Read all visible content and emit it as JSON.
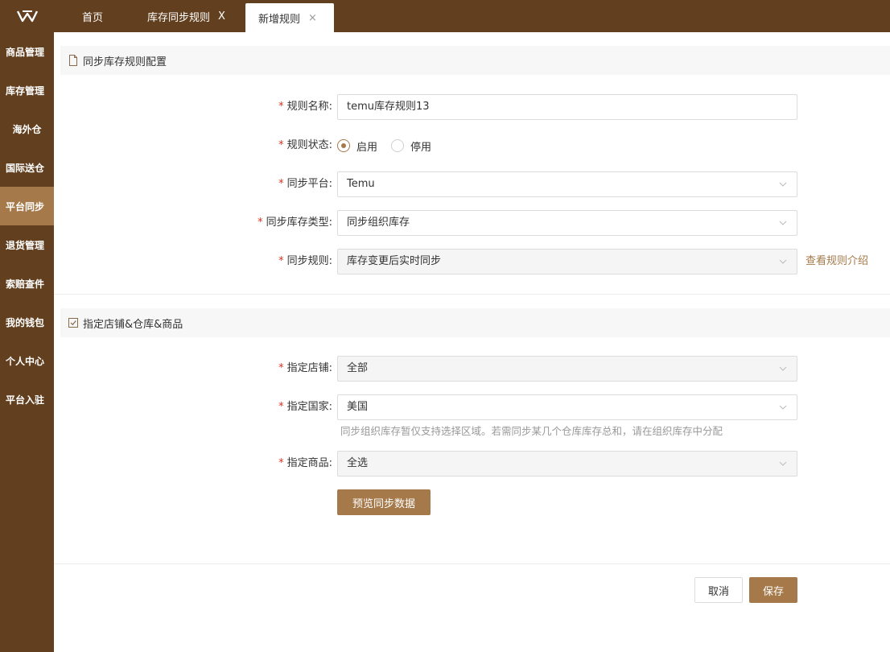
{
  "tabs": {
    "home": "首页",
    "rules": "库存同步规则",
    "new_rule": "新增规则",
    "close_glyph": "X",
    "close_glyph_small": "×"
  },
  "sidebar": {
    "items": [
      "商品管理",
      "库存管理",
      "海外仓",
      "国际送仓",
      "平台同步",
      "退货管理",
      "索赔查件",
      "我的钱包",
      "个人中心",
      "平台入驻"
    ],
    "active_index": 4
  },
  "section1": {
    "title": "同步库存规则配置",
    "rule_name": {
      "label": "规则名称:",
      "value": "temu库存规则13"
    },
    "rule_status": {
      "label": "规则状态:",
      "options": [
        "启用",
        "停用"
      ],
      "selected": "启用"
    },
    "platform": {
      "label": "同步平台:",
      "value": "Temu"
    },
    "stock_type": {
      "label": "同步库存类型:",
      "value": "同步组织库存"
    },
    "sync_rule": {
      "label": "同步规则:",
      "value": "库存变更后实时同步",
      "link": "查看规则介绍"
    }
  },
  "section2": {
    "title": "指定店铺&仓库&商品",
    "store": {
      "label": "指定店铺:",
      "value": "全部"
    },
    "country": {
      "label": "指定国家:",
      "value": "美国",
      "hint": "同步组织库存暂仅支持选择区域。若需同步某几个仓库库存总和，请在组织库存中分配"
    },
    "product": {
      "label": "指定商品:",
      "value": "全选"
    },
    "preview_button": "预览同步数据"
  },
  "footer": {
    "cancel": "取消",
    "save": "保存"
  },
  "required_mark": "*",
  "colors": {
    "brand": "#623f1e",
    "accent": "#a6794a",
    "required": "#e0301e"
  }
}
